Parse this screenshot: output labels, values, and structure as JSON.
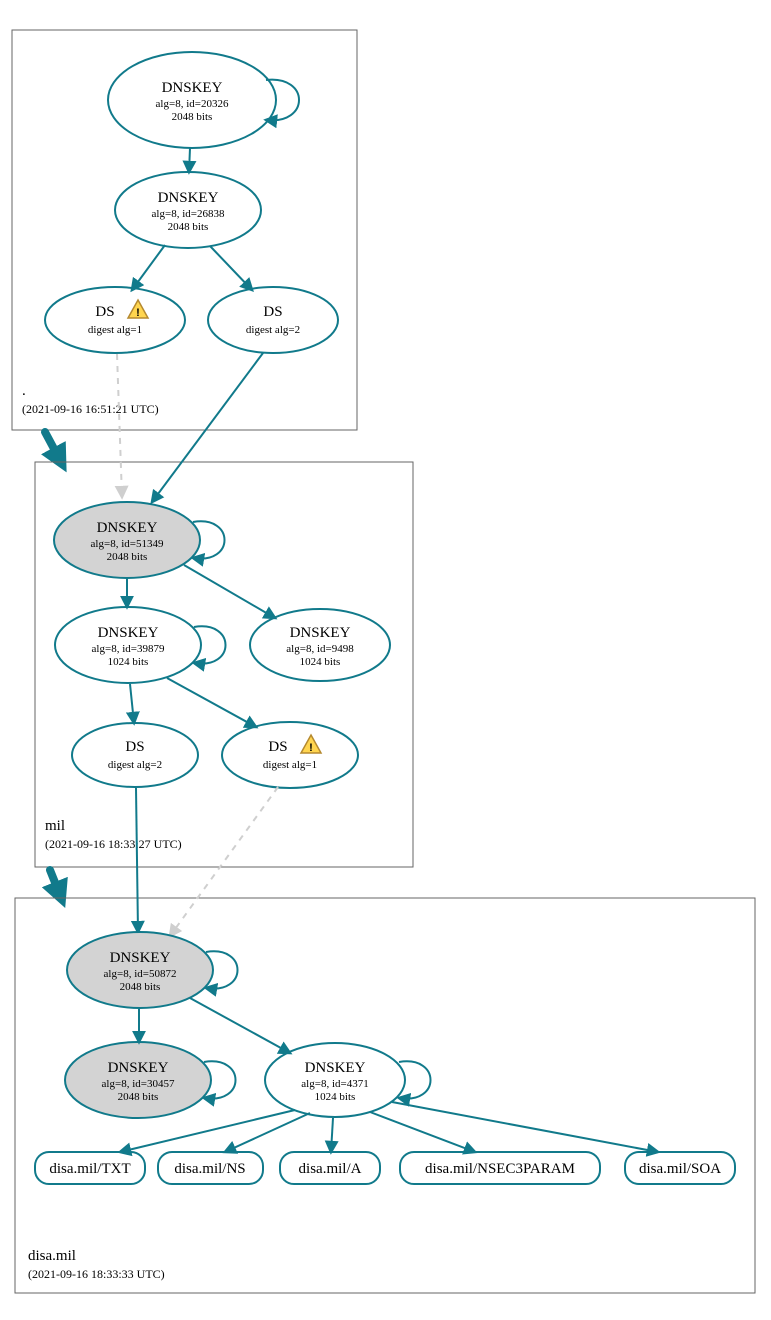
{
  "zones": {
    "root": {
      "name": ".",
      "timestamp": "(2021-09-16 16:51:21 UTC)"
    },
    "mil": {
      "name": "mil",
      "timestamp": "(2021-09-16 18:33:27 UTC)"
    },
    "disa": {
      "name": "disa.mil",
      "timestamp": "(2021-09-16 18:33:33 UTC)"
    }
  },
  "nodes": {
    "root_ksk": {
      "title": "DNSKEY",
      "sub1": "alg=8, id=20326",
      "sub2": "2048 bits"
    },
    "root_zsk": {
      "title": "DNSKEY",
      "sub1": "alg=8, id=26838",
      "sub2": "2048 bits"
    },
    "root_ds1": {
      "title": "DS",
      "sub1": "digest alg=1"
    },
    "root_ds2": {
      "title": "DS",
      "sub1": "digest alg=2"
    },
    "mil_ksk": {
      "title": "DNSKEY",
      "sub1": "alg=8, id=51349",
      "sub2": "2048 bits"
    },
    "mil_zsk": {
      "title": "DNSKEY",
      "sub1": "alg=8, id=39879",
      "sub2": "1024 bits"
    },
    "mil_zsk2": {
      "title": "DNSKEY",
      "sub1": "alg=8, id=9498",
      "sub2": "1024 bits"
    },
    "mil_ds2": {
      "title": "DS",
      "sub1": "digest alg=2"
    },
    "mil_ds1": {
      "title": "DS",
      "sub1": "digest alg=1"
    },
    "disa_ksk": {
      "title": "DNSKEY",
      "sub1": "alg=8, id=50872",
      "sub2": "2048 bits"
    },
    "disa_ksk2": {
      "title": "DNSKEY",
      "sub1": "alg=8, id=30457",
      "sub2": "2048 bits"
    },
    "disa_zsk": {
      "title": "DNSKEY",
      "sub1": "alg=8, id=4371",
      "sub2": "1024 bits"
    },
    "rr_txt": {
      "label": "disa.mil/TXT"
    },
    "rr_ns": {
      "label": "disa.mil/NS"
    },
    "rr_a": {
      "label": "disa.mil/A"
    },
    "rr_nsec3p": {
      "label": "disa.mil/NSEC3PARAM"
    },
    "rr_soa": {
      "label": "disa.mil/SOA"
    }
  }
}
